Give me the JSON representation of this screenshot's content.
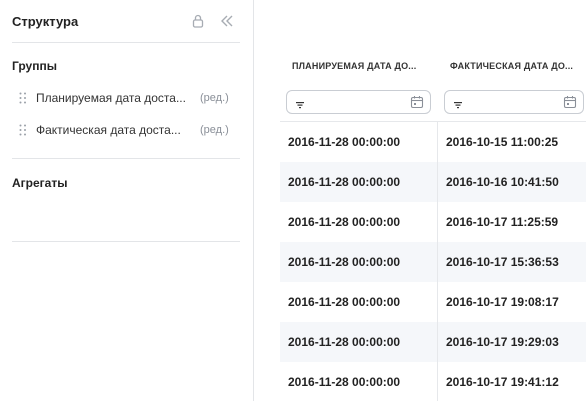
{
  "sidebar": {
    "title": "Структура",
    "icons": {
      "lock": "lock-icon",
      "collapse": "double-chevron-left-icon"
    },
    "groups": {
      "title": "Группы",
      "items": [
        {
          "label": "Планируемая дата доста...",
          "edit": "(ред.)"
        },
        {
          "label": "Фактическая дата доста...",
          "edit": "(ред.)"
        }
      ]
    },
    "aggregates": {
      "title": "Агрегаты"
    }
  },
  "table": {
    "columns": [
      {
        "header": "ПЛАНИРУЕМАЯ ДАТА ДО...",
        "filter_icon": "filter-icon",
        "calendar_icon": "calendar-icon"
      },
      {
        "header": "ФАКТИЧЕСКАЯ ДАТА ДО...",
        "filter_icon": "filter-icon",
        "calendar_icon": "calendar-icon"
      }
    ],
    "rows": [
      [
        "2016-11-28 00:00:00",
        "2016-10-15 11:00:25"
      ],
      [
        "2016-11-28 00:00:00",
        "2016-10-16 10:41:50"
      ],
      [
        "2016-11-28 00:00:00",
        "2016-10-17 11:25:59"
      ],
      [
        "2016-11-28 00:00:00",
        "2016-10-17 15:36:53"
      ],
      [
        "2016-11-28 00:00:00",
        "2016-10-17 19:08:17"
      ],
      [
        "2016-11-28 00:00:00",
        "2016-10-17 19:29:03"
      ],
      [
        "2016-11-28 00:00:00",
        "2016-10-17 19:41:12"
      ]
    ]
  },
  "colors": {
    "border": "#e3e5e8",
    "alt_row": "#f5f7fa",
    "muted_text": "#8a8f98"
  }
}
